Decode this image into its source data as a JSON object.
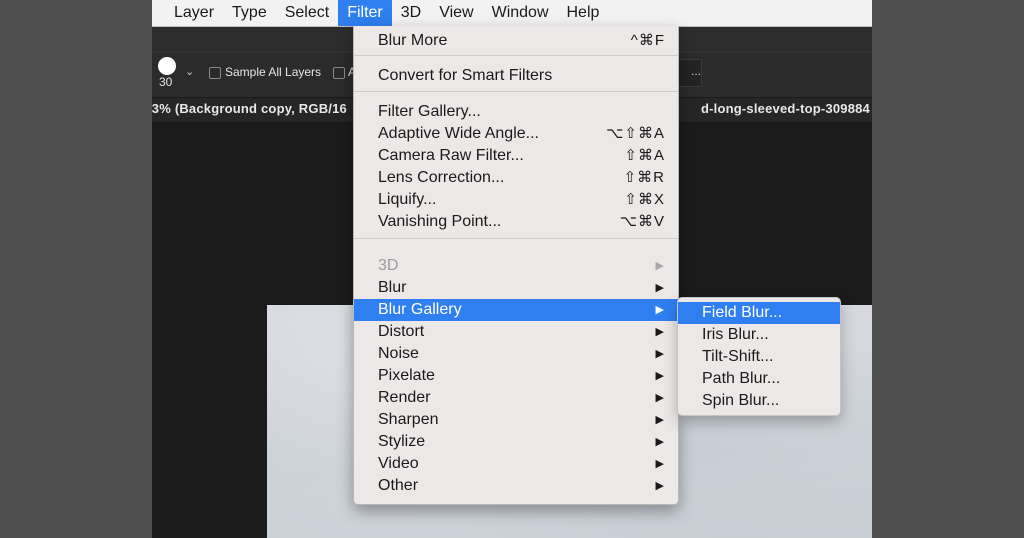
{
  "menubar": {
    "items": [
      "Layer",
      "Type",
      "Select",
      "Filter",
      "3D",
      "View",
      "Window",
      "Help"
    ],
    "active": "Filter"
  },
  "options_bar": {
    "brush_size": "30",
    "sample_all_layers_label": "Sample All Layers",
    "second_checkbox_label": "A",
    "field_value": "..."
  },
  "document_tab": {
    "left_text": ".3% (Background copy, RGB/16",
    "right_text": "d-long-sleeved-top-309884"
  },
  "filter_menu": {
    "items": [
      {
        "label": "Blur More",
        "shortcut": "^⌘F"
      },
      {
        "label": "Convert for Smart Filters",
        "shortcut": ""
      },
      {
        "label": "Filter Gallery...",
        "shortcut": ""
      },
      {
        "label": "Adaptive Wide Angle...",
        "shortcut": "⌥⇧⌘A"
      },
      {
        "label": "Camera Raw Filter...",
        "shortcut": "⇧⌘A"
      },
      {
        "label": "Lens Correction...",
        "shortcut": "⇧⌘R"
      },
      {
        "label": "Liquify...",
        "shortcut": "⇧⌘X"
      },
      {
        "label": "Vanishing Point...",
        "shortcut": "⌥⌘V"
      },
      {
        "label": "3D",
        "submenu": true,
        "disabled": true
      },
      {
        "label": "Blur",
        "submenu": true
      },
      {
        "label": "Blur Gallery",
        "submenu": true,
        "highlighted": true
      },
      {
        "label": "Distort",
        "submenu": true
      },
      {
        "label": "Noise",
        "submenu": true
      },
      {
        "label": "Pixelate",
        "submenu": true
      },
      {
        "label": "Render",
        "submenu": true
      },
      {
        "label": "Sharpen",
        "submenu": true
      },
      {
        "label": "Stylize",
        "submenu": true
      },
      {
        "label": "Video",
        "submenu": true
      },
      {
        "label": "Other",
        "submenu": true
      }
    ],
    "submenu_arrow": "▶"
  },
  "blur_gallery_submenu": {
    "items": [
      "Field Blur...",
      "Iris Blur...",
      "Tilt-Shift...",
      "Path Blur...",
      "Spin Blur..."
    ],
    "highlighted": "Field Blur..."
  },
  "colors": {
    "highlight": "#2f7ff0",
    "menu_bg": "#ece8e7",
    "app_bg": "#1c1c1c"
  }
}
